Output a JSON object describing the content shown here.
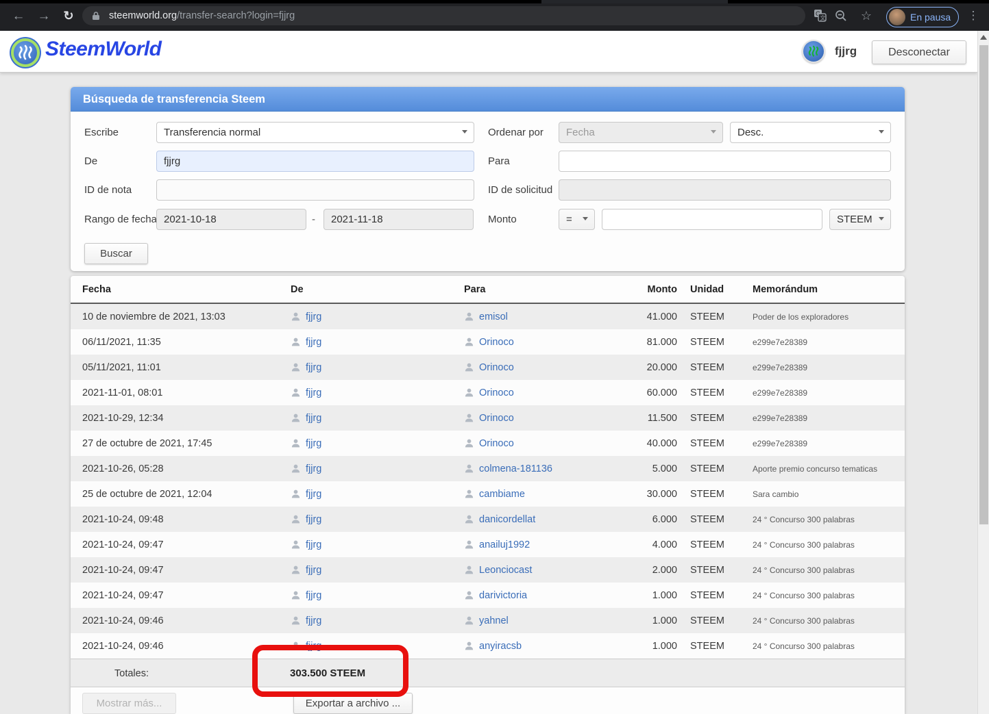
{
  "browser": {
    "url": {
      "host": "steemworld.org",
      "path": "/transfer-search?login=fjjrg"
    },
    "profile_chip": "En pausa"
  },
  "site_header": {
    "brand": "SteemWorld",
    "username": "fjjrg",
    "logout": "Desconectar"
  },
  "search_panel": {
    "title": "Búsqueda de transferencia Steem",
    "type": {
      "label": "Escribe",
      "value": "Transferencia normal"
    },
    "order": {
      "label": "Ordenar por",
      "value": "Fecha",
      "direction": "Desc."
    },
    "from": {
      "label": "De",
      "value": "fjjrg"
    },
    "to": {
      "label": "Para",
      "value": ""
    },
    "memo_id": {
      "label": "ID de nota",
      "value": ""
    },
    "request_id": {
      "label": "ID de solicitud",
      "value": ""
    },
    "date_range": {
      "label": "Rango de fecha",
      "from": "2021-10-18",
      "separator": "-",
      "to": "2021-11-18"
    },
    "amount": {
      "label": "Monto",
      "operator": "=",
      "value": "",
      "unit": "STEEM"
    },
    "search_button": "Buscar"
  },
  "table": {
    "columns": [
      "Fecha",
      "De",
      "Para",
      "Monto",
      "Unidad",
      "Memorándum"
    ],
    "rows": [
      {
        "date": "10 de noviembre de 2021, 13:03",
        "from": "fjjrg",
        "to": "emisol",
        "amount": "41.000",
        "unit": "STEEM",
        "memo": "Poder de los exploradores"
      },
      {
        "date": "06/11/2021, 11:35",
        "from": "fjjrg",
        "to": "Orinoco",
        "amount": "81.000",
        "unit": "STEEM",
        "memo": "e299e7e28389"
      },
      {
        "date": "05/11/2021, 11:01",
        "from": "fjjrg",
        "to": "Orinoco",
        "amount": "20.000",
        "unit": "STEEM",
        "memo": "e299e7e28389"
      },
      {
        "date": "2021-11-01, 08:01",
        "from": "fjjrg",
        "to": "Orinoco",
        "amount": "60.000",
        "unit": "STEEM",
        "memo": "e299e7e28389"
      },
      {
        "date": "2021-10-29, 12:34",
        "from": "fjjrg",
        "to": "Orinoco",
        "amount": "11.500",
        "unit": "STEEM",
        "memo": "e299e7e28389"
      },
      {
        "date": "27 de octubre de 2021, 17:45",
        "from": "fjjrg",
        "to": "Orinoco",
        "amount": "40.000",
        "unit": "STEEM",
        "memo": "e299e7e28389"
      },
      {
        "date": "2021-10-26, 05:28",
        "from": "fjjrg",
        "to": "colmena-181136",
        "amount": "5.000",
        "unit": "STEEM",
        "memo": "Aporte premio concurso tematicas"
      },
      {
        "date": "25 de octubre de 2021, 12:04",
        "from": "fjjrg",
        "to": "cambiame",
        "amount": "30.000",
        "unit": "STEEM",
        "memo": "Sara cambio"
      },
      {
        "date": "2021-10-24, 09:48",
        "from": "fjjrg",
        "to": "danicordellat",
        "amount": "6.000",
        "unit": "STEEM",
        "memo": "24 ° Concurso 300 palabras"
      },
      {
        "date": "2021-10-24, 09:47",
        "from": "fjjrg",
        "to": "anailuj1992",
        "amount": "4.000",
        "unit": "STEEM",
        "memo": "24 ° Concurso 300 palabras"
      },
      {
        "date": "2021-10-24, 09:47",
        "from": "fjjrg",
        "to": "Leonciocast",
        "amount": "2.000",
        "unit": "STEEM",
        "memo": "24 ° Concurso 300 palabras"
      },
      {
        "date": "2021-10-24, 09:47",
        "from": "fjjrg",
        "to": "darivictoria",
        "amount": "1.000",
        "unit": "STEEM",
        "memo": "24 ° Concurso 300 palabras"
      },
      {
        "date": "2021-10-24, 09:46",
        "from": "fjjrg",
        "to": "yahnel",
        "amount": "1.000",
        "unit": "STEEM",
        "memo": "24 ° Concurso 300 palabras"
      },
      {
        "date": "2021-10-24, 09:46",
        "from": "fjjrg",
        "to": "anyiracsb",
        "amount": "1.000",
        "unit": "STEEM",
        "memo": "24 ° Concurso 300 palabras"
      }
    ],
    "totals": {
      "label": "Totales:",
      "value": "303.500 STEEM"
    }
  },
  "footer": {
    "show_more": "Mostrar más...",
    "export": "Exportar a archivo ..."
  },
  "annotation": {
    "type": "red-highlight-box"
  },
  "colors": {
    "annotation_red": "#e8100e",
    "panel_header_blue": "#5e95de",
    "link_blue": "#3a6db8",
    "autofill_blue": "#e8f0fe",
    "chip_blue": "#8ab4f8"
  }
}
